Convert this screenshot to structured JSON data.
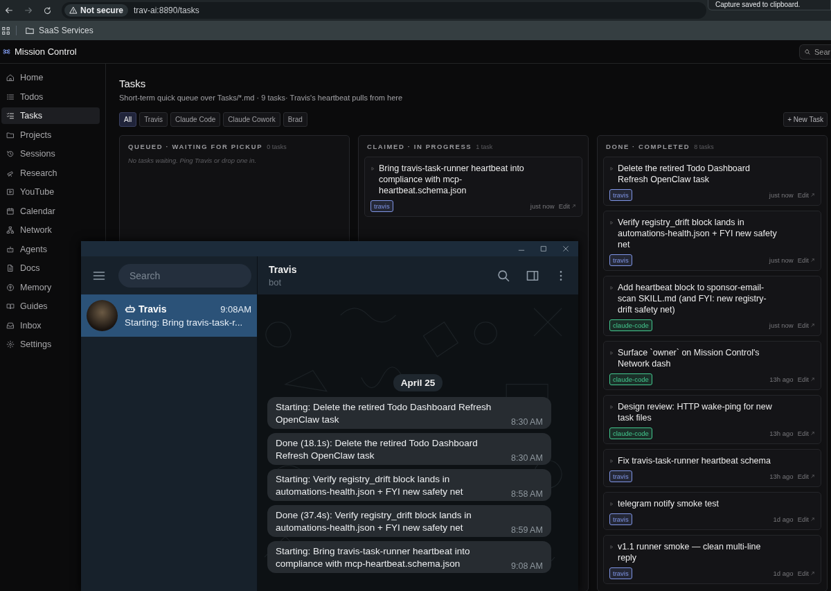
{
  "browser": {
    "security_label": "Not secure",
    "url": "trav-ai:8890/tasks",
    "bookmarks": [
      {
        "label": "SaaS Services"
      }
    ],
    "toast": "Capture saved to clipboard."
  },
  "app": {
    "title": "Mission Control",
    "search": {
      "placeholder": "Sear"
    }
  },
  "sidebar": {
    "items": [
      {
        "label": "Home",
        "selected": false
      },
      {
        "label": "Todos",
        "selected": false
      },
      {
        "label": "Tasks",
        "selected": true
      },
      {
        "label": "Projects",
        "selected": false
      },
      {
        "label": "Sessions",
        "selected": false
      },
      {
        "label": "Research",
        "selected": false
      },
      {
        "label": "YouTube",
        "selected": false
      },
      {
        "label": "Calendar",
        "selected": false
      },
      {
        "label": "Network",
        "selected": false
      },
      {
        "label": "Agents",
        "selected": false
      },
      {
        "label": "Docs",
        "selected": false
      },
      {
        "label": "Memory",
        "selected": false
      },
      {
        "label": "Guides",
        "selected": false
      },
      {
        "label": "Inbox",
        "selected": false
      },
      {
        "label": "Settings",
        "selected": false
      }
    ]
  },
  "page": {
    "title": "Tasks",
    "subtitle": "Short-term quick queue over Tasks/*.md · 9 tasks· Travis's heartbeat pulls from here",
    "filters": [
      {
        "label": "All",
        "selected": true
      },
      {
        "label": "Travis",
        "selected": false
      },
      {
        "label": "Claude Code",
        "selected": false
      },
      {
        "label": "Claude Cowork",
        "selected": false
      },
      {
        "label": "Brad",
        "selected": false
      }
    ],
    "new_button": "+ New Task"
  },
  "columns": [
    {
      "title": "QUEUED · WAITING FOR PICKUP",
      "count": "0 tasks",
      "empty_text": "No tasks waiting. Ping Travis or drop one in."
    },
    {
      "title": "CLAIMED · IN PROGRESS",
      "count": "1 task",
      "tasks": [
        {
          "title": "Bring travis-task-runner heartbeat into compliance with mcp-heartbeat.schema.json",
          "tag": {
            "label": "travis",
            "color": "#7f95e6"
          },
          "time": "just now",
          "edit": "Edit"
        }
      ]
    },
    {
      "title": "DONE · COMPLETED",
      "count": "8 tasks",
      "tasks": [
        {
          "title": "Delete the retired Todo Dashboard Refresh OpenClaw task",
          "tag": {
            "label": "travis",
            "color": "#7f95e6"
          },
          "time": "just now",
          "edit": "Edit"
        },
        {
          "title": "Verify registry_drift block lands in automations-health.json + FYI new safety net",
          "tag": {
            "label": "travis",
            "color": "#7f95e6"
          },
          "time": "just now",
          "edit": "Edit"
        },
        {
          "title": "Add heartbeat block to sponsor-email-scan SKILL.md (and FYI: new registry-drift safety net)",
          "tag": {
            "label": "claude-code",
            "color": "#43c98f"
          },
          "time": "just now",
          "edit": "Edit"
        },
        {
          "title": "Surface `owner` on Mission Control's Network dash",
          "tag": {
            "label": "claude-code",
            "color": "#43c98f"
          },
          "time": "13h ago",
          "edit": "Edit"
        },
        {
          "title": "Design review: HTTP wake-ping for new task files",
          "tag": {
            "label": "claude-code",
            "color": "#43c98f"
          },
          "time": "13h ago",
          "edit": "Edit"
        },
        {
          "title": "Fix travis-task-runner heartbeat schema",
          "tag": {
            "label": "travis",
            "color": "#7f95e6"
          },
          "time": "13h ago",
          "edit": "Edit"
        },
        {
          "title": "telegram notify smoke test",
          "tag": {
            "label": "travis",
            "color": "#7f95e6"
          },
          "time": "1d ago",
          "edit": "Edit"
        },
        {
          "title": "v1.1 runner smoke — clean multi-line reply",
          "tag": {
            "label": "travis",
            "color": "#7f95e6"
          },
          "time": "1d ago",
          "edit": "Edit"
        }
      ]
    }
  ],
  "chat_window": {
    "search": {
      "placeholder": "Search"
    },
    "chats": [
      {
        "name": "Travis",
        "time": "9:08AM",
        "preview": "Starting: Bring travis-task-r...",
        "selected": true
      }
    ],
    "header": {
      "name": "Travis",
      "status": "bot"
    },
    "date": "April 25",
    "messages": [
      {
        "text": "Starting: Delete the retired Todo Dashboard Refresh OpenClaw task",
        "time": "8:30 AM"
      },
      {
        "text": "Done (18.1s): Delete the retired Todo Dashboard Refresh OpenClaw task",
        "time": "8:30 AM"
      },
      {
        "text": "Starting: Verify registry_drift block lands in automations-health.json + FYI new safety net",
        "time": "8:58 AM"
      },
      {
        "text": "Done (37.4s): Verify registry_drift block lands in automations-health.json + FYI new safety net",
        "time": "8:59 AM"
      },
      {
        "text": "Starting: Bring travis-task-runner heartbeat into compliance with mcp-heartbeat.schema.json",
        "time": "9:08 AM"
      }
    ]
  }
}
